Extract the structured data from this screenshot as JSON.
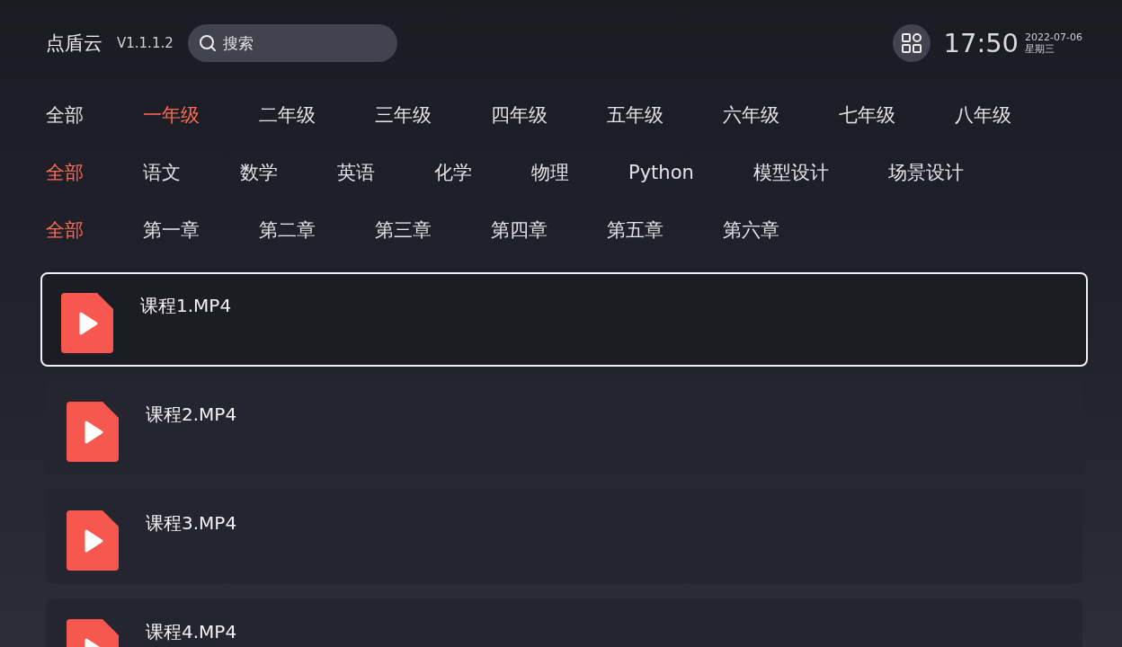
{
  "app": {
    "title": "点盾云",
    "version": "V1.1.1.2"
  },
  "search": {
    "placeholder": "搜索"
  },
  "clock": {
    "time": "17:50",
    "date": "2022-07-06",
    "weekday": "星期三"
  },
  "filters": [
    {
      "items": [
        {
          "label": "全部",
          "selected": false
        },
        {
          "label": "一年级",
          "selected": true
        },
        {
          "label": "二年级",
          "selected": false
        },
        {
          "label": "三年级",
          "selected": false
        },
        {
          "label": "四年级",
          "selected": false
        },
        {
          "label": "五年级",
          "selected": false
        },
        {
          "label": "六年级",
          "selected": false
        },
        {
          "label": "七年级",
          "selected": false
        },
        {
          "label": "八年级",
          "selected": false
        }
      ]
    },
    {
      "items": [
        {
          "label": "全部",
          "selected": true
        },
        {
          "label": "语文",
          "selected": false
        },
        {
          "label": "数学",
          "selected": false
        },
        {
          "label": "英语",
          "selected": false
        },
        {
          "label": "化学",
          "selected": false
        },
        {
          "label": "物理",
          "selected": false
        },
        {
          "label": "Python",
          "selected": false
        },
        {
          "label": "模型设计",
          "selected": false
        },
        {
          "label": "场景设计",
          "selected": false
        }
      ]
    },
    {
      "items": [
        {
          "label": "全部",
          "selected": true
        },
        {
          "label": "第一章",
          "selected": false
        },
        {
          "label": "第二章",
          "selected": false
        },
        {
          "label": "第三章",
          "selected": false
        },
        {
          "label": "第四章",
          "selected": false
        },
        {
          "label": "第五章",
          "selected": false
        },
        {
          "label": "第六章",
          "selected": false
        }
      ]
    }
  ],
  "files": [
    {
      "name": "课程1.MP4",
      "selected": true
    },
    {
      "name": "课程2.MP4",
      "selected": false
    },
    {
      "name": "课程3.MP4",
      "selected": false
    },
    {
      "name": "课程4.MP4",
      "selected": false
    }
  ]
}
